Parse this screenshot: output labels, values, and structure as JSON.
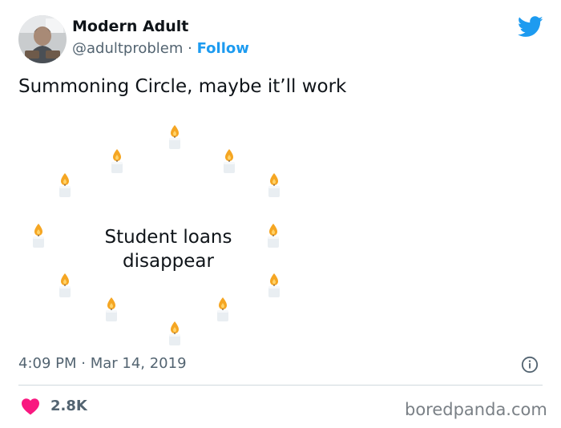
{
  "author": {
    "name": "Modern Adult",
    "handle": "@adultproblem",
    "separator": "·",
    "follow_label": "Follow"
  },
  "tweet": {
    "text": "Summoning Circle, maybe it’ll work",
    "image_text_line1": "Student loans",
    "image_text_line2": "disappear",
    "candle_icon": "candle-icon",
    "candle_count": 12
  },
  "meta": {
    "timestamp": "4:09 PM · Mar 14, 2019",
    "likes": "2.8K"
  },
  "watermark": "boredpanda.com",
  "colors": {
    "twitter_blue": "#1d9bf0",
    "text_primary": "#0f1419",
    "text_secondary": "#536471",
    "heart": "#f91880",
    "flame": "#f5a623",
    "candle": "#e9eef2"
  }
}
